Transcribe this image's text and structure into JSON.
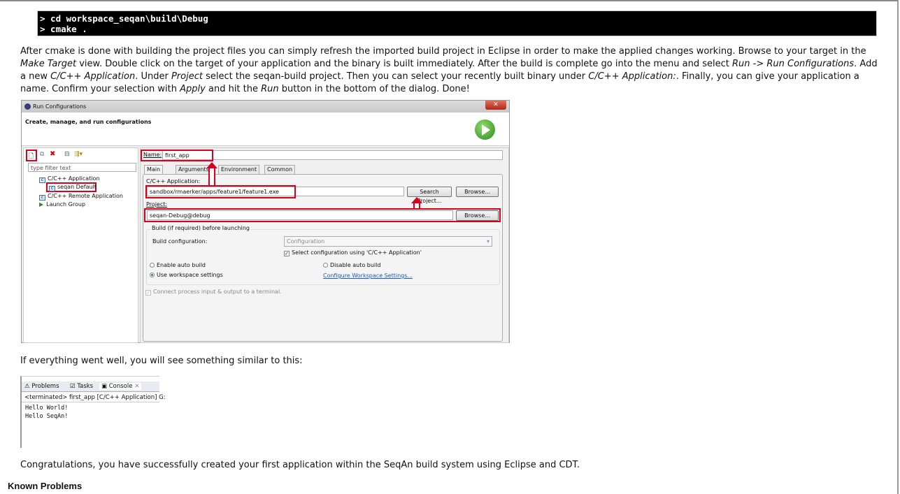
{
  "code": {
    "lines": [
      "> cd workspace_seqan\\build\\Debug",
      "> cmake ."
    ]
  },
  "intro": {
    "p1": "After cmake is done with building the project files you can simply refresh the imported build project in Eclipse in order to make the applied changes working. Browse to your target in the ",
    "make_target": "Make Target",
    "p2": " view. Double click on the target of your application and the binary is built immediately. After the build is complete go into the menu and select ",
    "run_cfg": "Run -> Run Configurations",
    "p3": ". Add a new ",
    "cc_app": "C/C++ Application",
    "p4": ". Under ",
    "project": "Project",
    "p5": " select the seqan-build project. Then you can select your recently built binary under ",
    "cc_app2": "C/C++ Application:",
    "p6": ". Finally, you can give your application a name. Confirm your selection with ",
    "apply": "Apply",
    "p7": " and hit the ",
    "run": "Run",
    "p8": " button in the bottom of the dialog. Done!"
  },
  "dialog": {
    "title": "Run Configurations",
    "header": "Create, manage, and run configurations",
    "filter_placeholder": "type filter text",
    "tree": [
      "C/C++ Application",
      "seqan Default",
      "C/C++ Remote Application",
      "Launch Group"
    ],
    "name_label": "Name:",
    "name_value": "first_app",
    "tabs": [
      "Main",
      "Arguments",
      "Environment",
      "Common"
    ],
    "app_label": "C/C++ Application:",
    "app_value": "sandbox/rmaerker/apps/feature1/feature1.exe",
    "search_project": "Search Project...",
    "browse": "Browse...",
    "project_label": "Project:",
    "project_value": "seqan-Debug@debug",
    "build_group": "Build (if required) before launching",
    "build_config_label": "Build configuration:",
    "build_config_value": "Configuration",
    "select_config": "Select configuration using 'C/C++ Application'",
    "enable_auto": "Enable auto build",
    "disable_auto": "Disable auto build",
    "use_workspace": "Use workspace settings",
    "configure_ws": "Configure Workspace Settings...",
    "connect_terminal": "Connect process input & output to a terminal."
  },
  "mid_text": "If everything went well, you will see something similar to this:",
  "console": {
    "tabs": [
      "Problems",
      "Tasks",
      "Console"
    ],
    "terminated": "<terminated> first_app [C/C++ Application] G:",
    "output": [
      "Hello World!",
      "Hello SeqAn!"
    ]
  },
  "congrats": "Congratulations, you have successfully created your first application within the SeqAn build system using Eclipse and CDT.",
  "known_problems": "Known Problems"
}
